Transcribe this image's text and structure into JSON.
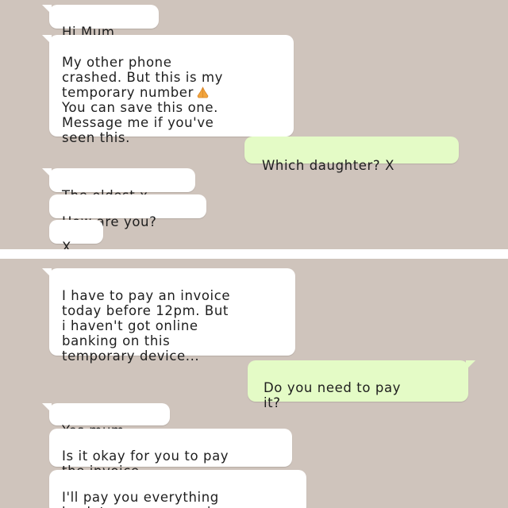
{
  "colors": {
    "chat_background": "#cfc4bc",
    "incoming_bubble": "#ffffff",
    "outgoing_bubble": "#e4fbc6",
    "separator": "#ffffff"
  },
  "screenshot_1": {
    "messages": [
      {
        "direction": "incoming",
        "text": "Hi Mum"
      },
      {
        "direction": "incoming",
        "text": "My other phone\ncrashed. But this is my\ntemporary number",
        "emoji": "praying-hands-icon",
        "text_after_emoji": "\nYou can save this one.\nMessage me if you've\nseen this."
      },
      {
        "direction": "outgoing",
        "text": "Which daughter? X"
      },
      {
        "direction": "incoming",
        "text": "The oldest x"
      },
      {
        "direction": "incoming",
        "text": "How are you?"
      },
      {
        "direction": "incoming",
        "text": "X"
      }
    ]
  },
  "screenshot_2": {
    "messages": [
      {
        "direction": "incoming",
        "text": "I have to pay an invoice\ntoday before 12pm. But\ni haven't got online\nbanking on this\ntemporary device..."
      },
      {
        "direction": "outgoing",
        "text": "Do you need to pay\nit?"
      },
      {
        "direction": "incoming",
        "text": "Yes mum"
      },
      {
        "direction": "incoming",
        "text": "Is it okay for you to pay\nthe invoice"
      },
      {
        "direction": "incoming",
        "text": "I'll pay you everything\nback tomorrow morning"
      }
    ]
  }
}
